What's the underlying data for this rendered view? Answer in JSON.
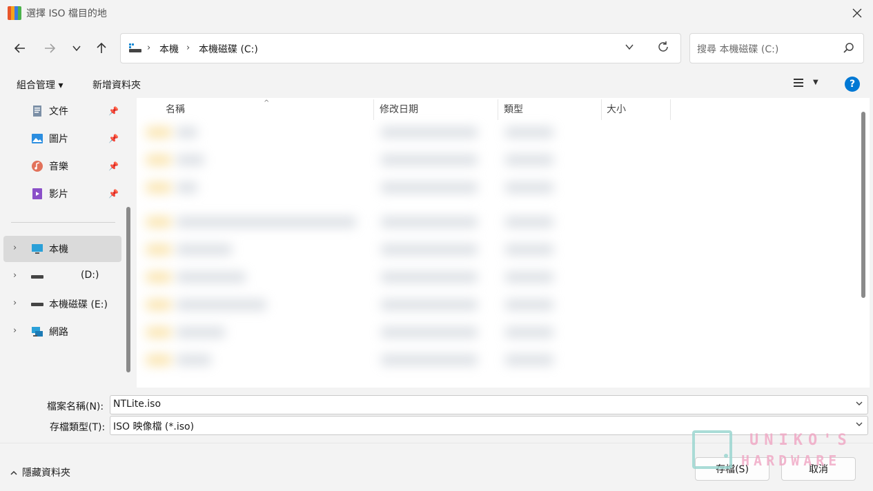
{
  "window": {
    "title": "選擇 ISO 檔目的地",
    "close_icon": "close-icon"
  },
  "address": {
    "breadcrumbs": [
      "本機",
      "本機磁碟 (C:)"
    ],
    "search_placeholder": "搜尋 本機磁碟 (C:)"
  },
  "toolbar": {
    "organize_label": "組合管理 ▾",
    "new_folder_label": "新增資料夾"
  },
  "sidebar": {
    "quick_access": [
      {
        "label": "文件",
        "icon": "document-icon"
      },
      {
        "label": "圖片",
        "icon": "picture-icon"
      },
      {
        "label": "音樂",
        "icon": "music-icon"
      },
      {
        "label": "影片",
        "icon": "video-icon"
      }
    ],
    "locations": [
      {
        "label": "本機",
        "icon": "computer-icon",
        "selected": true
      },
      {
        "label": "(D:)",
        "icon": "drive-icon"
      },
      {
        "label": "本機磁碟 (E:)",
        "icon": "drive-icon"
      },
      {
        "label": "網路",
        "icon": "network-icon"
      }
    ]
  },
  "filelist": {
    "columns": [
      "名稱",
      "修改日期",
      "類型",
      "大小"
    ]
  },
  "form": {
    "filename_label": "檔案名稱(N):",
    "filename_value": "NTLite.iso",
    "filetype_label": "存檔類型(T):",
    "filetype_value": "ISO 映像檔 (*.iso)"
  },
  "footer": {
    "hide_folders_label": "隱藏資料夾",
    "save_label": "存檔(S)",
    "cancel_label": "取消"
  },
  "watermark": {
    "line1": "UNIKO'S",
    "line2": "HARDWARE"
  },
  "colors": {
    "accent": "#0078d4",
    "selection": "#dadada",
    "background": "#f3f3f3"
  }
}
